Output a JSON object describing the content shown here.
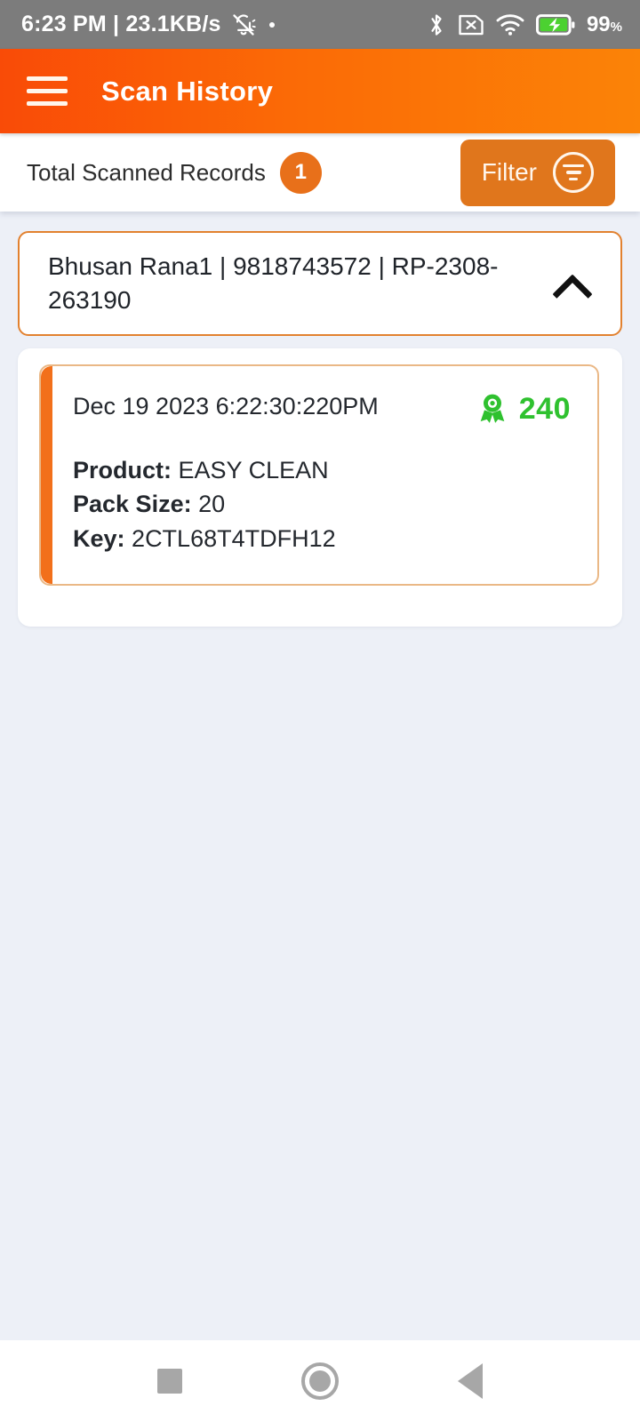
{
  "status_bar": {
    "clock_and_speed": "6:23 PM | 23.1KB/s",
    "mute_icon": "bell-muted-icon",
    "dot_icon": "notification-dot-icon",
    "bluetooth_icon": "bluetooth-icon",
    "sim_icon": "sim-card-off-icon",
    "wifi_icon": "wifi-icon",
    "battery_icon": "battery-charging-icon",
    "battery_percent": "99",
    "battery_percent_unit": "%",
    "background": "#7c7c7c"
  },
  "app_bar": {
    "menu_icon": "hamburger-menu-icon",
    "title": "Scan History",
    "gradient_start": "#f94b07",
    "gradient_end": "#fb8307"
  },
  "summary": {
    "label": "Total Scanned Records",
    "count": "1",
    "badge_color": "#e8701a",
    "filter": {
      "label": "Filter",
      "icon": "filter-icon",
      "background": "#e0761c"
    }
  },
  "record": {
    "header_title": "Bhusan Rana1 | 9818743572 | RP-2308-263190",
    "expanded": true,
    "toggle_icon": "chevron-up-icon",
    "border_color": "#e2812f",
    "scan": {
      "datetime": "Dec 19 2023 6:22:30:220PM",
      "points_icon": "award-ribbon-icon",
      "points_value": "240",
      "points_color": "#2fc12f",
      "accent_color": "#f2701b",
      "fields": [
        {
          "key": "Product:",
          "value": "EASY CLEAN"
        },
        {
          "key": "Pack Size:",
          "value": "20"
        },
        {
          "key": "Key:",
          "value": "2CTL68T4TDFH12"
        }
      ]
    }
  },
  "nav_bar": {
    "recents_icon": "recents-square-icon",
    "home_icon": "home-circle-icon",
    "back_icon": "back-triangle-icon"
  }
}
